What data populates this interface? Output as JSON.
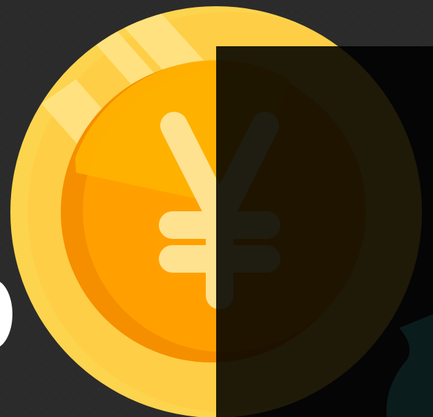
{
  "scene": {
    "subject": "yen-coin",
    "colors": {
      "chalkboard": "#2b2b2b",
      "coin_outer": "#FDD44D",
      "coin_inner": "#FFA000",
      "coin_inner_shadow": "#F58F00",
      "coin_inner_highlight": "#FFB300",
      "coin_glint": "#FFE48A",
      "yen_symbol": "#FFE28F",
      "dark_overlay": "#000000",
      "cyan_shape": "#5EE1EC",
      "white_shape": "#FFFFFF"
    }
  }
}
